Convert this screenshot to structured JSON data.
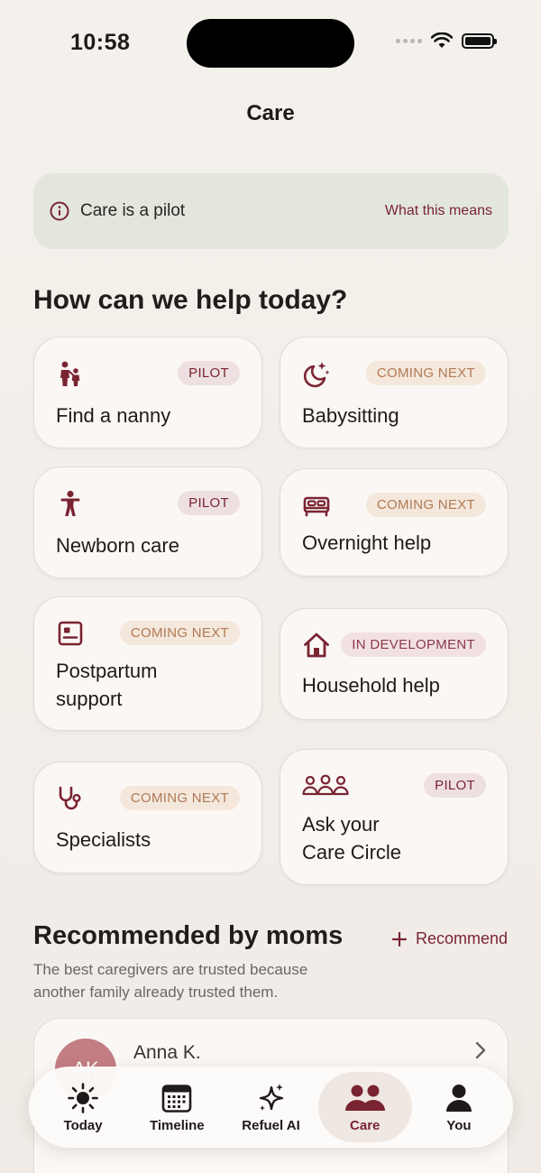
{
  "status_bar": {
    "time": "10:58"
  },
  "header": {
    "title": "Care"
  },
  "banner": {
    "text": "Care is a pilot",
    "link": "What this means",
    "icon": "info-icon"
  },
  "section": {
    "heading": "How can we help today?"
  },
  "cards": [
    {
      "label_line1": "Find a nanny",
      "label_line2": "",
      "badge": "PILOT",
      "badge_type": "pilot",
      "icon": "family-icon"
    },
    {
      "label_line1": "Babysitting",
      "label_line2": "",
      "badge": "COMING NEXT",
      "badge_type": "coming",
      "icon": "moon-stars-icon"
    },
    {
      "label_line1": "Newborn care",
      "label_line2": "",
      "badge": "PILOT",
      "badge_type": "pilot",
      "icon": "person-icon"
    },
    {
      "label_line1": "Overnight help",
      "label_line2": "",
      "badge": "COMING NEXT",
      "badge_type": "coming",
      "icon": "bed-icon"
    },
    {
      "label_line1": "Postpartum",
      "label_line2": "support",
      "badge": "COMING NEXT",
      "badge_type": "coming",
      "icon": "id-card-icon"
    },
    {
      "label_line1": "Household help",
      "label_line2": "",
      "badge": "IN DEVELOPMENT",
      "badge_type": "dev",
      "icon": "home-icon"
    },
    {
      "label_line1": "Specialists",
      "label_line2": "",
      "badge": "COMING NEXT",
      "badge_type": "coming",
      "icon": "stethoscope-icon"
    },
    {
      "label_line1": "Ask your",
      "label_line2": "Care Circle",
      "badge": "PILOT",
      "badge_type": "pilot",
      "icon": "group-icon"
    }
  ],
  "recommended": {
    "heading": "Recommended by moms",
    "action": "Recommend",
    "subtitle": "The best caregivers are trusted because another family already trusted them.",
    "caregivers": [
      {
        "initials": "AK",
        "name": "Anna K."
      }
    ]
  },
  "tabs": [
    {
      "label": "Today",
      "icon": "sun-icon",
      "active": false
    },
    {
      "label": "Timeline",
      "icon": "calendar-icon",
      "active": false
    },
    {
      "label": "Refuel AI",
      "icon": "sparkle-icon",
      "active": false
    },
    {
      "label": "Care",
      "icon": "people-icon",
      "active": true
    },
    {
      "label": "You",
      "icon": "profile-icon",
      "active": false
    }
  ],
  "colors": {
    "accent": "#7a2432",
    "pilot_badge": "#eee0e0",
    "coming_badge": "#f4e7dc",
    "banner_bg": "#e3e6dc"
  }
}
